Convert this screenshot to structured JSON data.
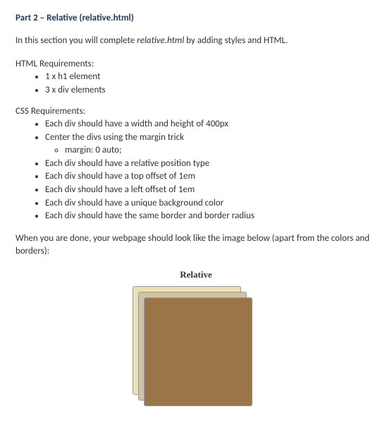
{
  "title": {
    "prefix": "Part 2 – ",
    "name": "Relative",
    "paren": " (relative.html)"
  },
  "intro": {
    "before": "In this section you will complete ",
    "file": "relative.html",
    "after": " by adding styles and HTML."
  },
  "html_req": {
    "label": "HTML Requirements:",
    "items": [
      "1 x h1 element",
      "3 x div elements"
    ]
  },
  "css_req": {
    "label": "CSS Requirements:",
    "items": [
      "Each div should have a width and height of 400px",
      "Center the divs using the margin trick",
      "Each div should have a relative position type",
      "Each div should have a top offset of 1em",
      "Each div should have a left offset of 1em",
      "Each div should have a unique background color",
      "Each div should have the same border and border radius"
    ],
    "margin_sub": "margin: 0 auto;"
  },
  "closing": "When you are done, your webpage should look like the image below (apart from the colors and borders):",
  "demo": {
    "heading": "Relative"
  }
}
